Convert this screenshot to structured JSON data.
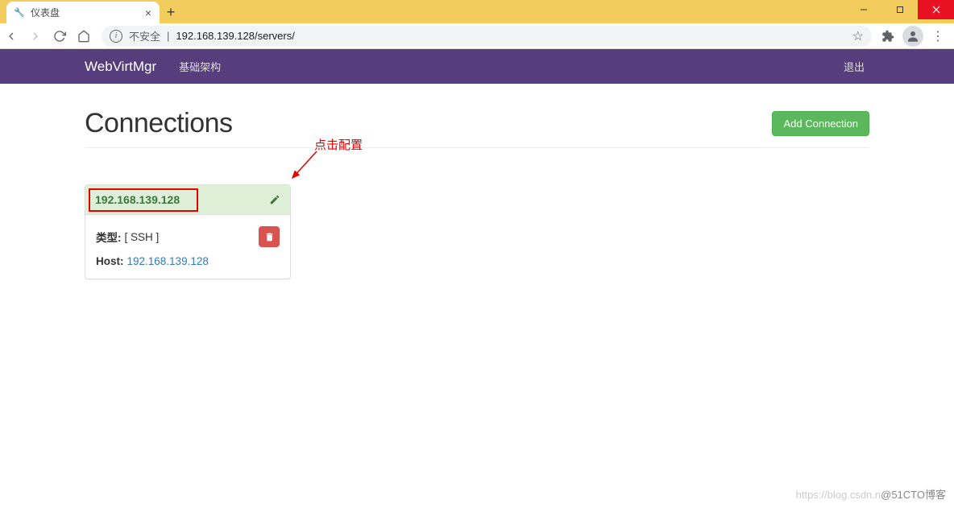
{
  "browser": {
    "tab_title": "仪表盘",
    "unsafe_label": "不安全",
    "url": "192.168.139.128/servers/"
  },
  "navbar": {
    "brand": "WebVirtMgr",
    "item1": "基础架构",
    "logout": "退出"
  },
  "header": {
    "title": "Connections",
    "add_button": "Add Connection"
  },
  "annotation": {
    "text": "点击配置"
  },
  "connection": {
    "host_title": "192.168.139.128",
    "type_label": "类型:",
    "type_value": "[ SSH ]",
    "host_label": "Host:",
    "host_value": "192.168.139.128"
  },
  "watermark": {
    "faint": "https://blog.csdn.n",
    "text": "@51CTO博客"
  }
}
